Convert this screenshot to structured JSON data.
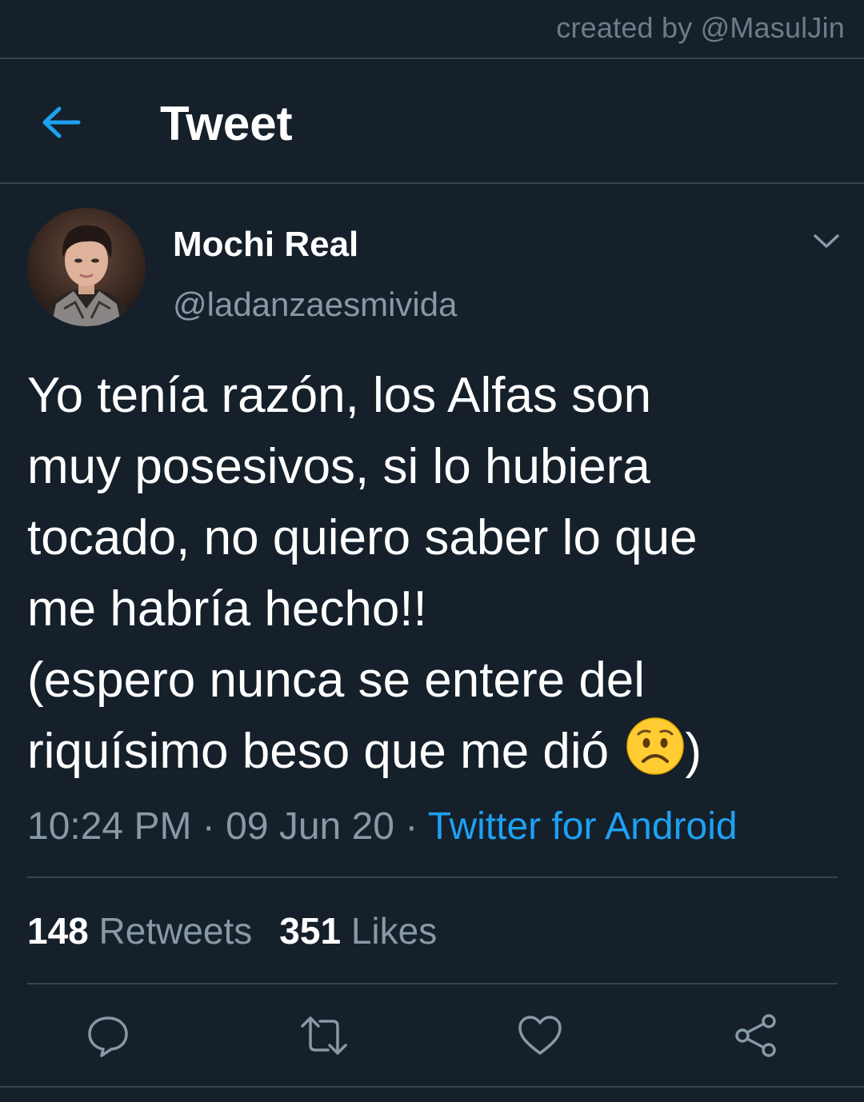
{
  "watermark": "created by @MasulJin",
  "header": {
    "back_icon": "arrow-left-icon",
    "title": "Tweet"
  },
  "tweet": {
    "author": {
      "display_name": "Mochi Real",
      "handle": "@ladanzaesmivida"
    },
    "menu_icon": "chevron-down-icon",
    "text_lines": [
      "Yo tenía razón, los Alfas son",
      "muy posesivos, si lo hubiera",
      "tocado, no quiero saber lo que",
      "me habría hecho!!",
      "(espero nunca se entere del",
      "riquísimo beso que me dió"
    ],
    "closing_paren": ")",
    "emoji": "worried-face-emoji",
    "time": "10:24 PM",
    "date": "09 Jun 20",
    "separator": "·",
    "source": "Twitter for Android",
    "stats": {
      "retweets_count": "148",
      "retweets_label": "Retweets",
      "likes_count": "351",
      "likes_label": "Likes"
    }
  },
  "actions": [
    "reply-icon",
    "retweet-icon",
    "like-icon",
    "share-icon"
  ],
  "colors": {
    "background": "#15202b",
    "divider": "#38444d",
    "text_primary": "#ffffff",
    "text_secondary": "#8899a6",
    "accent": "#1da1f2"
  }
}
